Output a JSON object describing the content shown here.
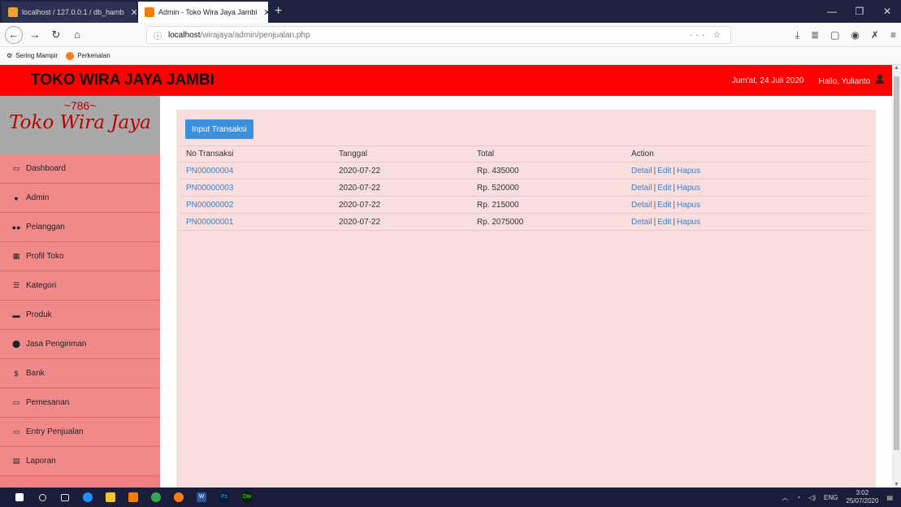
{
  "browser": {
    "tabs": [
      {
        "label": "localhost / 127.0.0.1 / db_hamb"
      },
      {
        "label": "Admin - Toko Wira Jaya Jambi"
      }
    ],
    "new_tab": "+",
    "url": {
      "host": "localhost",
      "path": "/wirajaya/admin/penjualan.php"
    },
    "bookmarks": [
      "Sering Mampir",
      "Perkenalan"
    ]
  },
  "header": {
    "title": "TOKO WIRA JAYA JAMBI",
    "date": "Jum'at, 24 Juli 2020",
    "greeting": "Hallo, Yulianto"
  },
  "sidebar": {
    "logo_top": "~786~",
    "logo_name": "Toko Wira Jaya",
    "items": [
      {
        "label": "Dashboard",
        "icon": "monitor-icon"
      },
      {
        "label": "Admin",
        "icon": "user-icon"
      },
      {
        "label": "Pelanggan",
        "icon": "users-icon"
      },
      {
        "label": "Profil Toko",
        "icon": "table-icon"
      },
      {
        "label": "Kategori",
        "icon": "list-icon"
      },
      {
        "label": "Produk",
        "icon": "briefcase-icon"
      },
      {
        "label": "Jasa Pengiriman",
        "icon": "map-marker-icon"
      },
      {
        "label": "Bank",
        "icon": "dollar-icon"
      },
      {
        "label": "Pemesanan",
        "icon": "credit-card-icon"
      },
      {
        "label": "Entry Penjualan",
        "icon": "credit-card-icon"
      },
      {
        "label": "Laporan",
        "icon": "report-icon"
      }
    ]
  },
  "main": {
    "input_button": "Input Transaksi",
    "columns": [
      "No Transaksi",
      "Tanggal",
      "Total",
      "Action"
    ],
    "rows": [
      {
        "no": "PN00000004",
        "tanggal": "2020-07-22",
        "total": "Rp. 435000"
      },
      {
        "no": "PN00000003",
        "tanggal": "2020-07-22",
        "total": "Rp. 520000"
      },
      {
        "no": "PN00000002",
        "tanggal": "2020-07-22",
        "total": "Rp. 215000"
      },
      {
        "no": "PN00000001",
        "tanggal": "2020-07-22",
        "total": "Rp. 2075000"
      }
    ],
    "actions": {
      "detail": "Detail",
      "edit": "Edit",
      "hapus": "Hapus",
      "separator": "|"
    }
  },
  "taskbar": {
    "lang": "ENG",
    "time": "3:02",
    "date": "25/07/2020"
  }
}
